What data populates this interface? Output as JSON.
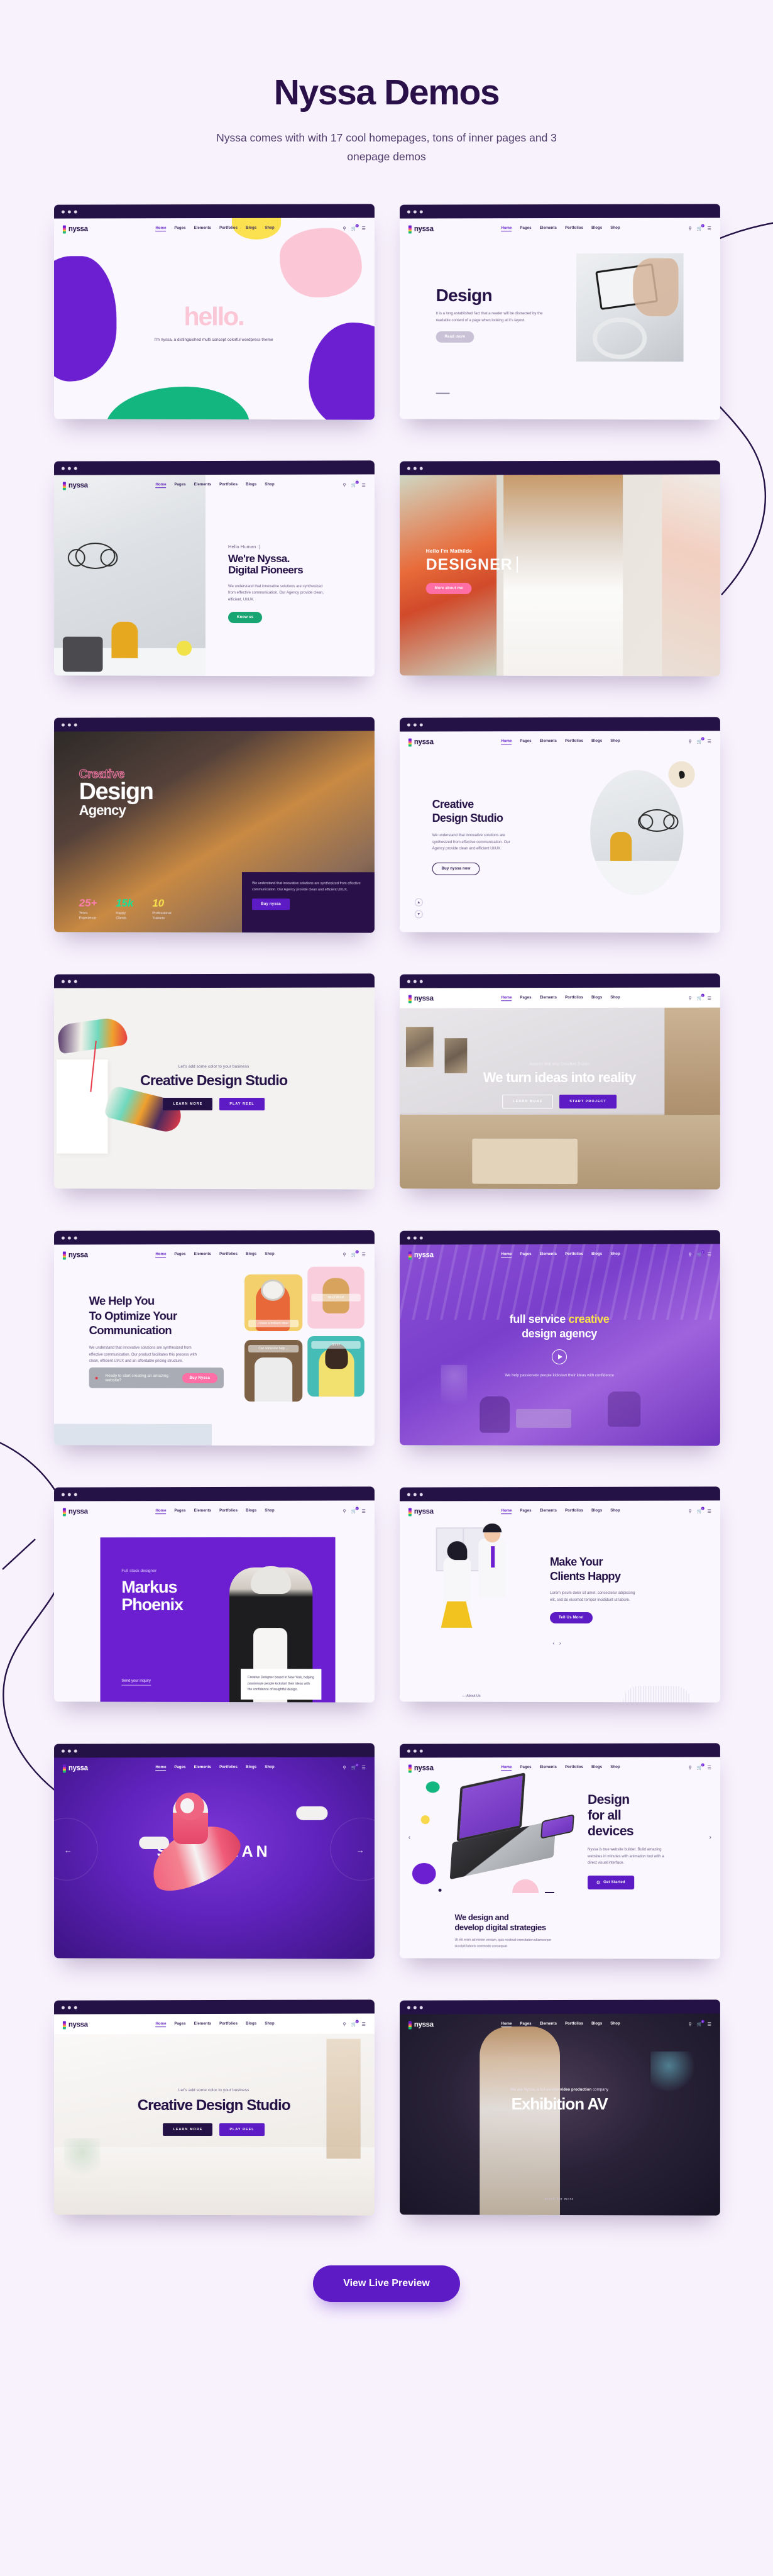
{
  "header": {
    "title": "Nyssa Demos",
    "subtitle": "Nyssa comes with with 17 cool homepages, tons of inner pages and 3 onepage demos"
  },
  "brand": {
    "name": "nyssa",
    "accent": "#5c1bc4",
    "dark": "#241146",
    "page_bg": "#f8f2fd"
  },
  "site_nav": {
    "links": [
      "Home",
      "Pages",
      "Elements",
      "Portfolios",
      "Blogs",
      "Shop"
    ],
    "active": "Home",
    "icons": [
      "search-icon",
      "cart-icon",
      "menu-icon"
    ],
    "cart_count": "0"
  },
  "footer": {
    "cta_label": "View Live Preview"
  },
  "demos": [
    {
      "id": "hello",
      "title": "hello",
      "title_suffix": ".",
      "subtitle": "I'm nyssa, a distinguished multi concept colorful wordpress theme"
    },
    {
      "id": "design",
      "title": "Design",
      "body": "It is a long established fact that a reader will be distracted by the readable content of a page when looking at it's layout.",
      "button": "Read more"
    },
    {
      "id": "digital-pioneers",
      "eyebrow": "Hello Human :)",
      "title": "We're Nyssa.\nDigital Pioneers",
      "body": "We understand that innovative solutions are synthesized from effective communication. Our Agency provide clean, efficient, UI/UX.",
      "button": "Know us"
    },
    {
      "id": "designer",
      "eyebrow": "Hello I'm Mathilde",
      "title": "DESIGNER",
      "button": "More about me"
    },
    {
      "id": "creative-design-agency",
      "outline_word": "Creative",
      "title": "Design",
      "subtitle": "Agency",
      "body": "We understand that innovative solutions are synthesized from effective communication. Our Agency provide clean and efficient UI/UX.",
      "button": "Buy nyssa",
      "stats": [
        {
          "value": "25+",
          "label": "Years\nExperience",
          "color": "#ff7fb0"
        },
        {
          "value": "15k",
          "label": "Happy\nClients",
          "color": "#16e39a"
        },
        {
          "value": "10",
          "label": "Professional\nTrainers",
          "color": "#f8e14c"
        }
      ]
    },
    {
      "id": "creative-design-studio-oval",
      "title": "Creative\nDesign Studio",
      "body": "We understand that innovative solutions are synthesized from effective communication. Our Agency provide clean and efficient UI/UX.",
      "button": "Buy nyssa now"
    },
    {
      "id": "sneakers",
      "eyebrow": "Let's add some color to your business",
      "title": "Creative Design Studio",
      "buttons": [
        "LEARN MORE",
        "PLAY REEL"
      ]
    },
    {
      "id": "ideas-into-reality",
      "eyebrow": "Awards Winning Creative Studio",
      "title": "We turn ideas into reality",
      "buttons": [
        "LEARN MORE",
        "START PROJECT"
      ]
    },
    {
      "id": "optimize-communication",
      "title": "We Help You\nTo Optimize Your\nCommunication",
      "body": "We understand that innovative solutions are synthesized from effective communication. Our product facilitates this process with clean, efficient UI/UX and an affordable pricing structure.",
      "cta_text": "Ready to start creating an amazing website?",
      "cta_button": "Buy Nyssa",
      "tile_captions": [
        "I have a brilliant idea!",
        "Woof Woof!",
        "Can someone help ...",
        "Shhh!"
      ]
    },
    {
      "id": "full-service-agency",
      "title_part1": "full service ",
      "title_highlight": "creative",
      "title_part2": "design agency",
      "subtitle": "We help passionate people kickstart their ideas with confidence",
      "play_icon": "play-icon"
    },
    {
      "id": "markus-phoenix",
      "eyebrow": "Full stack designer",
      "title": "Markus\nPhoenix",
      "link": "Send your inquiry",
      "card": "Creative Designer based in New York, helping passionate people kickstart their ideas with the confidence of insightful design."
    },
    {
      "id": "clients-happy",
      "title": "Make Your\nClients Happy",
      "body": "Lorem ipsum dolor sit amet, consectetur adipiscing elit, sed do eiusmod tempor incididunt ut labore.",
      "button": "Tell Us More!",
      "about_link": "About Us"
    },
    {
      "id": "spaceman",
      "title": "SPACEMAN"
    },
    {
      "id": "design-all-devices",
      "title": "Design\nfor all\ndevices",
      "body": "Nyssa is true website builder. Build amazing websites in minutes with animation tool with a direct visual interface.",
      "button": "Get Started",
      "lower_title": "We design and\ndevelop digital strategies",
      "lower_body": "Ut elit enim ad minim veniam, quis nostrud exercitation ullamcorper suscipit laboris commodo consequat."
    },
    {
      "id": "creative-design-studio-light",
      "eyebrow": "Let's add some color to your business",
      "title": "Creative Design Studio",
      "buttons": [
        "LEARN MORE",
        "PLAY REEL"
      ]
    },
    {
      "id": "exhibition-av",
      "eyebrow_prefix": "We are Nyssa, a full-service ",
      "eyebrow_bold": "video production",
      "eyebrow_suffix": " company",
      "title": "Exhibition AV",
      "scroll_hint": "scroll for more"
    }
  ]
}
